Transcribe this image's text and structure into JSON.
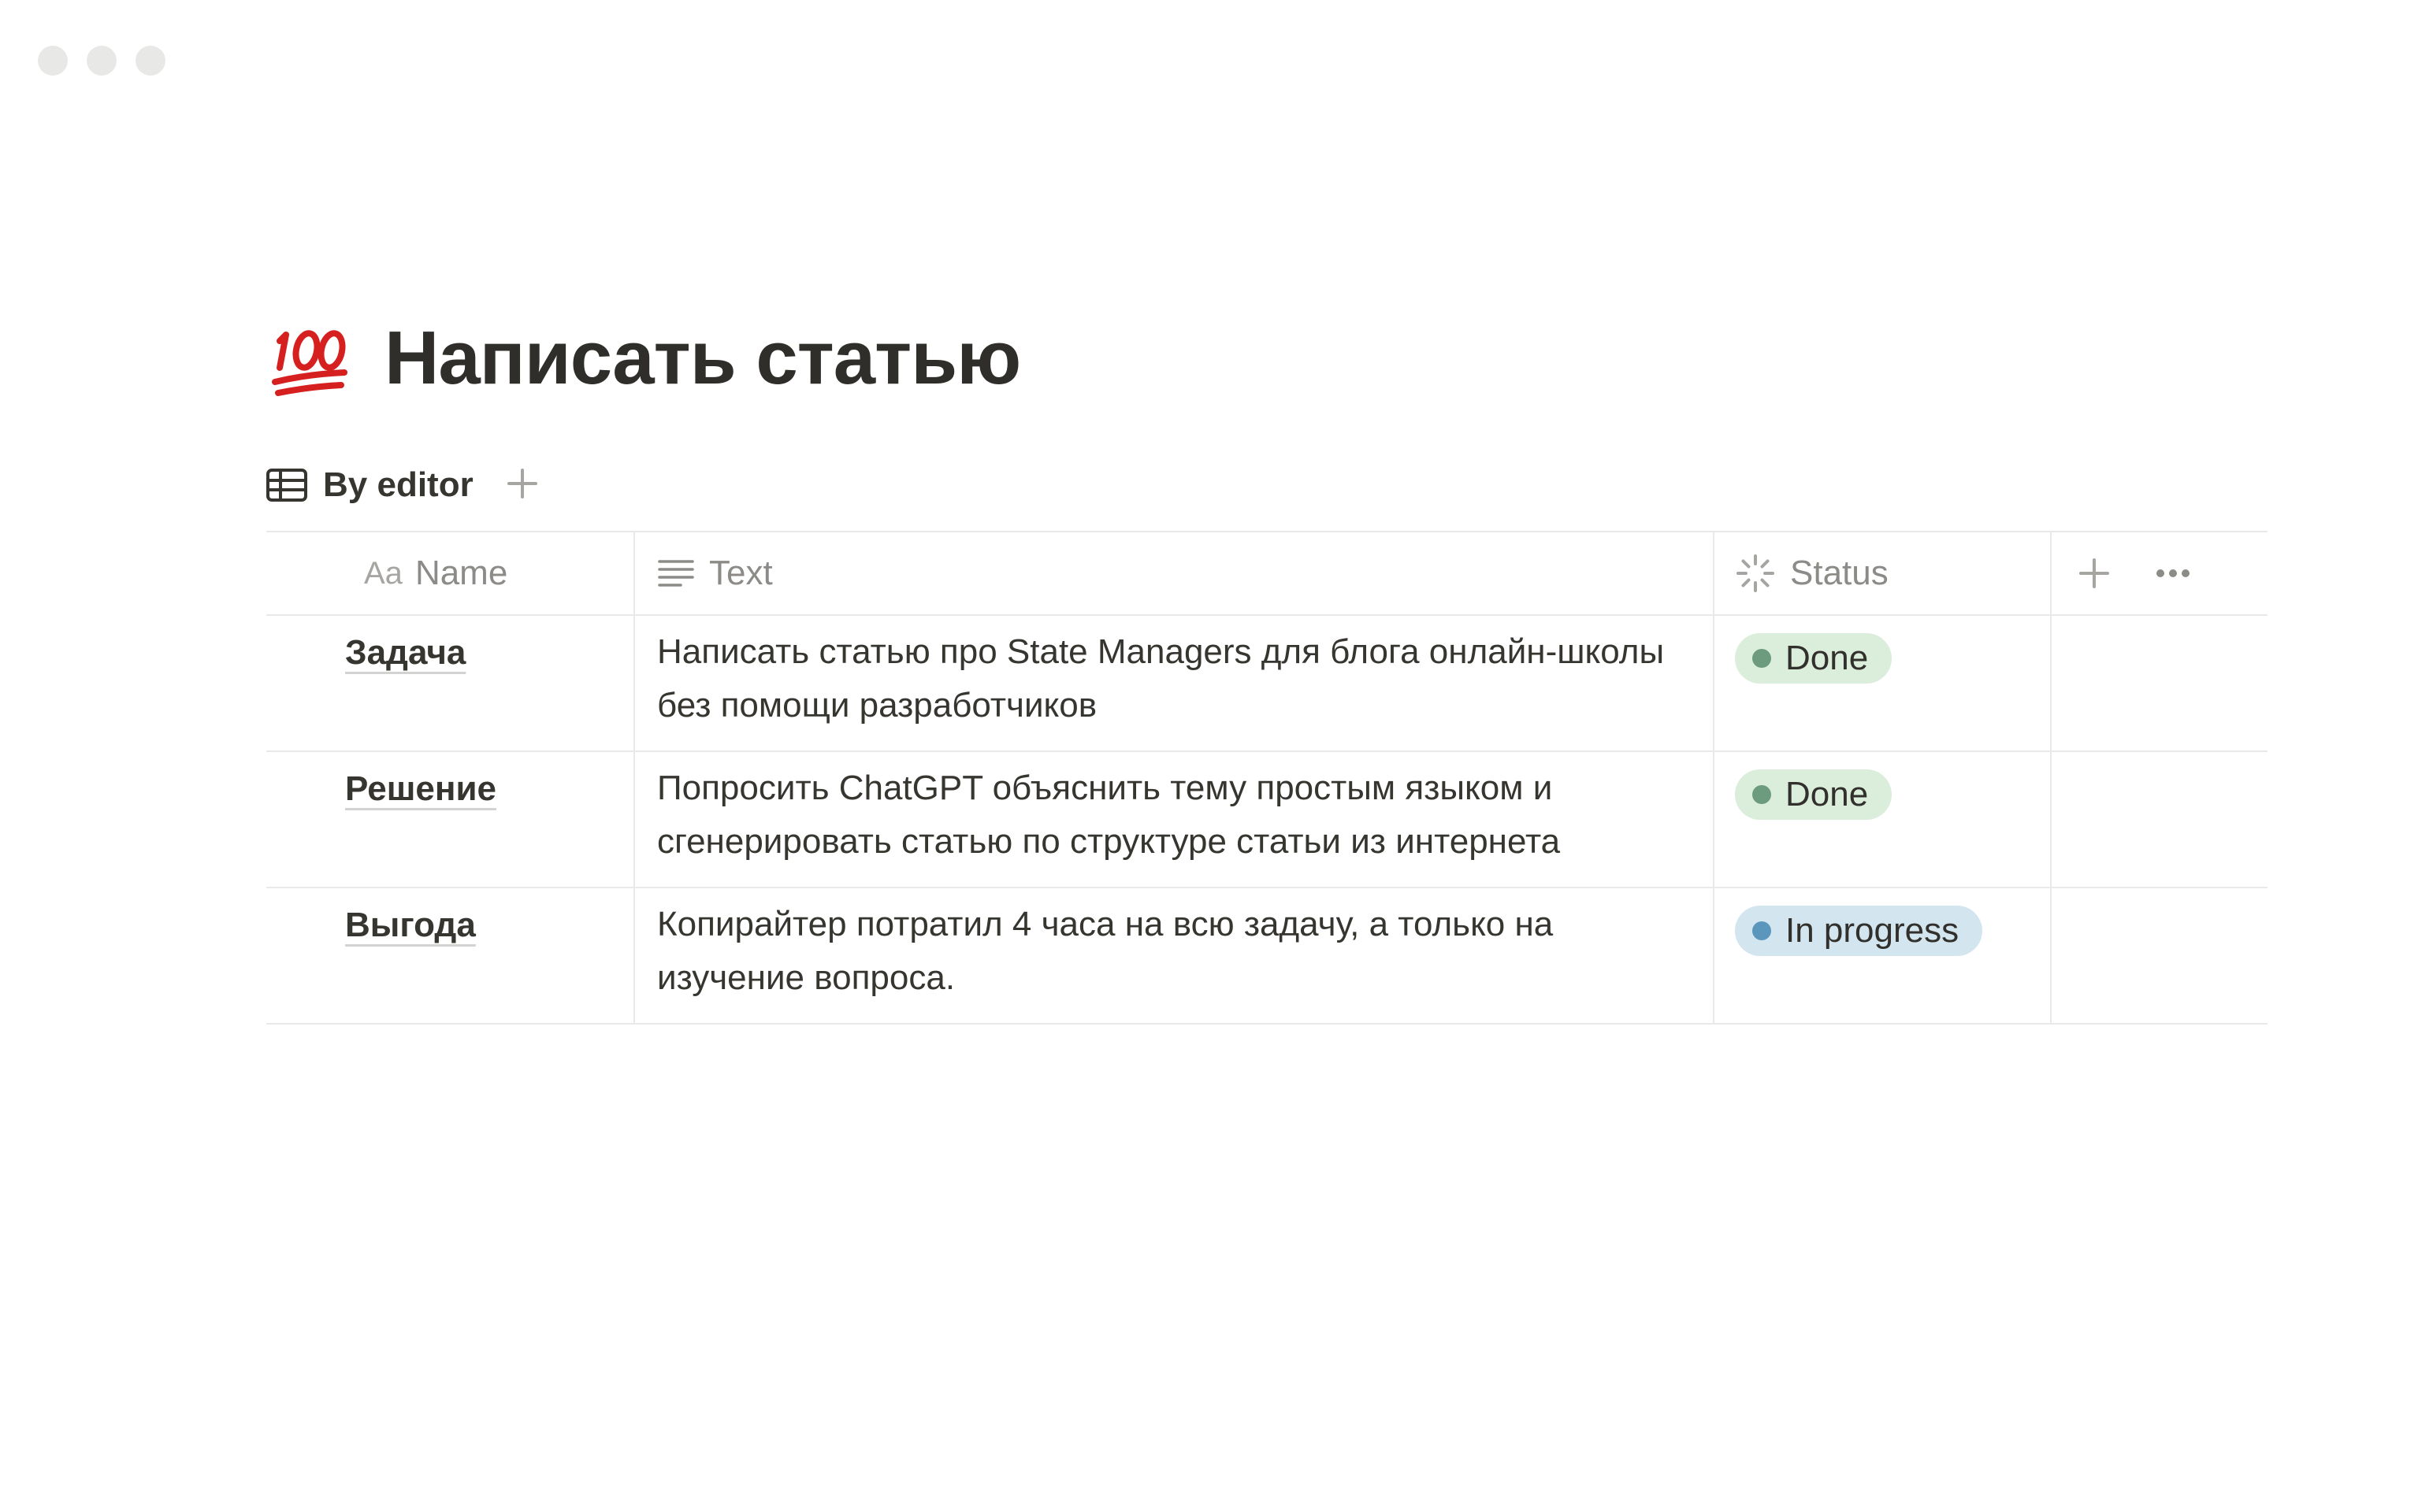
{
  "page": {
    "title": "Написать статью",
    "title_icon": "hundred-points-emoji",
    "views": [
      {
        "label": "By editor",
        "icon": "table-icon"
      }
    ]
  },
  "table": {
    "columns": [
      {
        "label": "Name",
        "prefix": "Aa"
      },
      {
        "label": "Text",
        "icon": "text-lines-icon"
      },
      {
        "label": "Status",
        "icon": "status-spinner-icon"
      }
    ],
    "rows": [
      {
        "name": "Задача",
        "text": "Написать статью про State Managers для блога онлайн-школы без помощи разработчиков",
        "status": "Done"
      },
      {
        "name": "Решение",
        "text": "Попросить ChatGPT объяснить тему простым языком и сгенерировать статью по структуре статьи из интернета",
        "status": "Done"
      },
      {
        "name": "Выгода",
        "text": "Копирайтер потратил 4 часа на всю задачу, а только на изучение вопроса.",
        "status": "In progress"
      }
    ]
  },
  "colors": {
    "done_bg": "#dbeddb",
    "done_dot": "#6c9b7d",
    "progress_bg": "#d3e5ef",
    "progress_dot": "#5b97bd"
  }
}
